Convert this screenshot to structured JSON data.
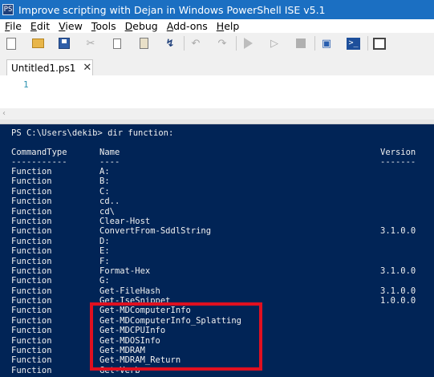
{
  "window": {
    "title": "Improve scripting with Dejan in Windows PowerShell ISE v5.1",
    "app_icon_text": "PS"
  },
  "menu": [
    {
      "accel": "F",
      "rest": "ile"
    },
    {
      "accel": "E",
      "rest": "dit"
    },
    {
      "accel": "V",
      "rest": "iew"
    },
    {
      "accel": "T",
      "rest": "ools"
    },
    {
      "accel": "D",
      "rest": "ebug"
    },
    {
      "accel": "A",
      "rest": "dd-ons"
    },
    {
      "accel": "H",
      "rest": "elp"
    }
  ],
  "toolbar": {
    "icons": [
      "new-script-icon",
      "open-folder-icon",
      "save-icon",
      "cut-icon",
      "copy-icon",
      "paste-icon",
      "clear-console-icon",
      "undo-icon",
      "redo-icon",
      "run-script-icon",
      "run-selection-icon",
      "stop-icon",
      "remote-powershell-icon",
      "powershell-icon",
      "layout-icon"
    ],
    "cut_glyph": "✂",
    "undo_glyph": "↶",
    "redo_glyph": "↷",
    "run_selection_glyph": "▷",
    "clear_glyph": "↯",
    "remote_glyph": "▣",
    "powershell_glyph": ">_"
  },
  "tab": {
    "label": "Untitled1.ps1",
    "close_glyph": "✕"
  },
  "editor": {
    "line_number": "1",
    "scroll_arrow": "‹"
  },
  "console": {
    "prompt": "PS C:\\Users\\dekib> dir function:",
    "headers": {
      "command_type": "CommandType",
      "name": "Name",
      "version": "Version"
    },
    "underlines": {
      "command_type": "-----------",
      "name": "----",
      "version": "-------"
    },
    "rows": [
      {
        "type": "Function",
        "name": "A:",
        "version": ""
      },
      {
        "type": "Function",
        "name": "B:",
        "version": ""
      },
      {
        "type": "Function",
        "name": "C:",
        "version": ""
      },
      {
        "type": "Function",
        "name": "cd..",
        "version": ""
      },
      {
        "type": "Function",
        "name": "cd\\",
        "version": ""
      },
      {
        "type": "Function",
        "name": "Clear-Host",
        "version": ""
      },
      {
        "type": "Function",
        "name": "ConvertFrom-SddlString",
        "version": "3.1.0.0"
      },
      {
        "type": "Function",
        "name": "D:",
        "version": ""
      },
      {
        "type": "Function",
        "name": "E:",
        "version": ""
      },
      {
        "type": "Function",
        "name": "F:",
        "version": ""
      },
      {
        "type": "Function",
        "name": "Format-Hex",
        "version": "3.1.0.0"
      },
      {
        "type": "Function",
        "name": "G:",
        "version": ""
      },
      {
        "type": "Function",
        "name": "Get-FileHash",
        "version": "3.1.0.0"
      },
      {
        "type": "Function",
        "name": "Get-IseSnippet",
        "version": "1.0.0.0"
      },
      {
        "type": "Function",
        "name": "Get-MDComputerInfo",
        "version": ""
      },
      {
        "type": "Function",
        "name": "Get-MDComputerInfo_Splatting",
        "version": ""
      },
      {
        "type": "Function",
        "name": "Get-MDCPUInfo",
        "version": ""
      },
      {
        "type": "Function",
        "name": "Get-MDOSInfo",
        "version": ""
      },
      {
        "type": "Function",
        "name": "Get-MDRAM",
        "version": ""
      },
      {
        "type": "Function",
        "name": "Get-MDRAM_Return",
        "version": ""
      },
      {
        "type": "Function",
        "name": "Get-Verb",
        "version": ""
      }
    ]
  }
}
